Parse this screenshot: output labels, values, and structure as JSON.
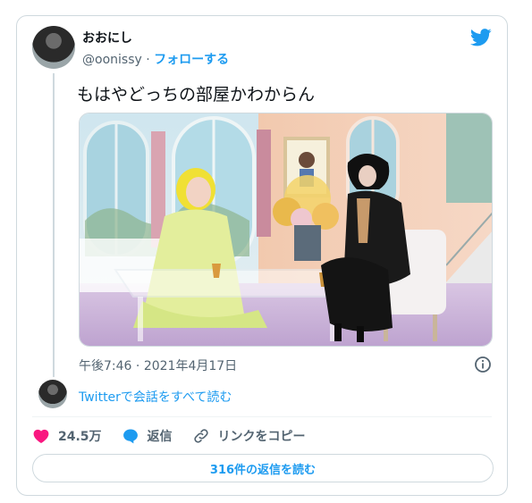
{
  "author": {
    "name": "おおにし",
    "handle": "@oonissy",
    "separator": "·",
    "follow_label": "フォローする"
  },
  "tweet": {
    "text": "もはやどっちの部屋かわからん",
    "time": "午後7:46",
    "date_separator": "·",
    "date": "2021年4月17日"
  },
  "thread": {
    "read_conversation": "Twitterで会話をすべて読む"
  },
  "actions": {
    "likes": "24.5万",
    "reply_label": "返信",
    "copy_link_label": "リンクをコピー"
  },
  "replies_button": "316件の返信を読む",
  "colors": {
    "brand_blue": "#1d9bf0",
    "like_pink": "#f91880",
    "muted_text": "#536471",
    "border": "#cfd9de"
  },
  "icons": [
    "twitter-bird-icon",
    "info-icon",
    "heart-icon",
    "reply-bubble-icon",
    "link-icon"
  ]
}
